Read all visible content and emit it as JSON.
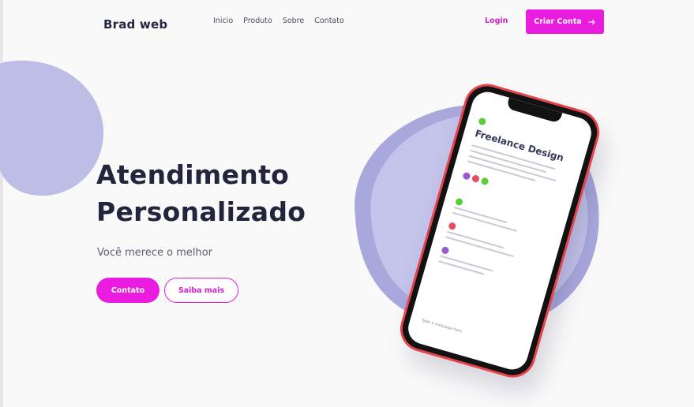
{
  "header": {
    "brand": "Brad web",
    "nav": [
      "Inicio",
      "Produto",
      "Sobre",
      "Contato"
    ],
    "login_label": "Login",
    "cta_label": "Criar Conta"
  },
  "hero": {
    "headline_line1": "Atendimento",
    "headline_line2": "Personalizado",
    "subtitle": "Você merece o melhor",
    "primary_button": "Contato",
    "secondary_button": "Saiba mais"
  },
  "colors": {
    "accent": "#e91ce0",
    "blob": "#b9b8e6",
    "text_dark": "#242742"
  },
  "phone_screen": {
    "title": "Freelance Design",
    "footer": "Type a message here"
  }
}
